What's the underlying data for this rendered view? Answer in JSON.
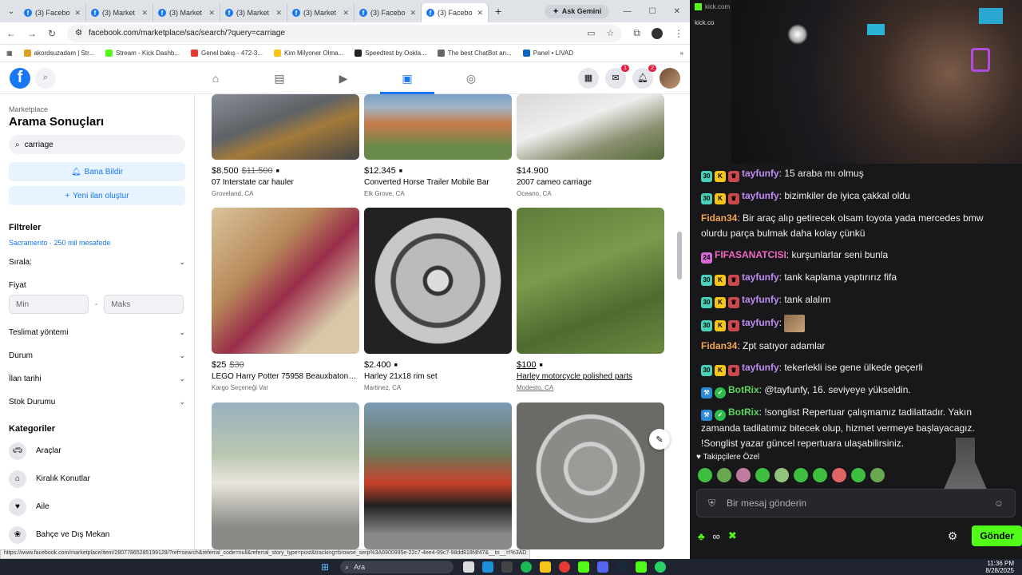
{
  "browser": {
    "tabs": [
      {
        "label": "(3) Facebo"
      },
      {
        "label": "(3) Market"
      },
      {
        "label": "(3) Market"
      },
      {
        "label": "(3) Market"
      },
      {
        "label": "(3) Market"
      },
      {
        "label": "(3) Facebo"
      },
      {
        "label": "(3) Facebo"
      }
    ],
    "gemini": "Ask Gemini",
    "url": "facebook.com/marketplace/sac/search/?query=carriage",
    "bookmarks": [
      {
        "label": "akordsuzadam | Str..."
      },
      {
        "label": "Stream - Kick Dashb..."
      },
      {
        "label": "Genel bakış - 472-3..."
      },
      {
        "label": "Kim Milyoner Olma..."
      },
      {
        "label": "Speedtest by Ookla..."
      },
      {
        "label": "The best ChatBot an..."
      },
      {
        "label": "Panel • LIVAD"
      }
    ],
    "status_url": "https://www.facebook.com/marketplace/item/28077865285199128/?ref=search&referral_code=null&referral_story_type=post&tracking=browse_serp%3A6900995e-22c7-4ee4-99c7-98dd818f4f47&__tn__=!%3AD"
  },
  "fb": {
    "badges": {
      "messenger": "1",
      "notifications": "2"
    },
    "sidebar": {
      "marketplace": "Marketplace",
      "title": "Arama Sonuçları",
      "search_value": "carriage",
      "notify_btn": "Bana Bildir",
      "create_btn": "Yeni ilan oluştur",
      "filters_heading": "Filtreler",
      "location": "Sacramento · 250 mil mesafede",
      "sort": "Sırala:",
      "price": "Fiyat",
      "min": "Min",
      "max": "Maks",
      "delivery": "Teslimat yöntemi",
      "condition": "Durum",
      "date_listed": "İlan tarihi",
      "availability": "Stok Durumu",
      "categories_heading": "Kategoriler",
      "categories": [
        {
          "label": "Araçlar",
          "icon": "car-icon"
        },
        {
          "label": "Kiralık Konutlar",
          "icon": "house-icon"
        },
        {
          "label": "Aile",
          "icon": "heart-icon"
        },
        {
          "label": "Bahçe ve Dış Mekan",
          "icon": "garden-icon"
        }
      ]
    },
    "listings": [
      {
        "price": "$8.500",
        "old": "$11.500",
        "title": "07 Interstate car hauler",
        "loc": "Groveland, CA"
      },
      {
        "price": "$12.345",
        "old": "",
        "title": "Converted Horse Trailer Mobile Bar",
        "loc": "Elk Grove, CA"
      },
      {
        "price": "$14.900",
        "old": "",
        "title": "2007 cameo carriage",
        "loc": "Oceano, CA"
      },
      {
        "price": "$25",
        "old": "$30",
        "title": "LEGO Harry Potter 75958 Beauxbatons ...",
        "loc": "Kargo Seçeneği Var"
      },
      {
        "price": "$2.400",
        "old": "",
        "title": "Harley 21x18 rim set",
        "loc": "Martinez, CA"
      },
      {
        "price": "$100",
        "old": "",
        "title": "Harley motorcycle polished parts",
        "loc": "Modesto, CA"
      }
    ]
  },
  "chat": {
    "tab_title": "kick.com",
    "tab_title2": "kick.co",
    "messages": [
      {
        "user": "Fidan3",
        "text": ""
      },
      {
        "user": "FIF",
        "text": ""
      },
      {
        "user": "Fidan3",
        "text": ""
      },
      {
        "user": "tayfunfy",
        "text": "15 araba mı olmuş"
      },
      {
        "user": "tayfunfy",
        "text": "bizimkiler de iyica çakkal oldu"
      },
      {
        "user": "Fidan34",
        "text": "Bir araç alıp getirecek olsam toyota yada mercedes bmw olurdu parça bulmak daha kolay çünkü"
      },
      {
        "user": "FIFASANATCISI",
        "text": "kurşunlarlar seni bunla"
      },
      {
        "user": "tayfunfy",
        "text": "tank kaplama yaptırırız fifa"
      },
      {
        "user": "tayfunfy",
        "text": "tank alalım"
      },
      {
        "user": "tayfunfy",
        "text": ""
      },
      {
        "user": "Fidan34",
        "text": "Zpt satıyor adamlar"
      },
      {
        "user": "tayfunfy",
        "text": "tekerlekli ise gene ülkede geçerli"
      },
      {
        "user": "BotRix",
        "text": "@tayfunfy, 16. seviyeye yükseldin."
      },
      {
        "user": "BotRix",
        "text": "!songlist Repertuar çalışmamız tadilattadır. Yakın zamanda tadilatımız bitecek olup, hizmet vermeye başlayacagız. !Songlist yazar güncel repertuara ulaşabilirsiniz."
      }
    ],
    "followers_label": "Takipçilere Özel",
    "input_placeholder": "Bir mesaj gönderin",
    "send": "Gönder"
  },
  "taskbar": {
    "search": "Ara",
    "time": "11:36 PM",
    "date": "8/28/2025"
  }
}
